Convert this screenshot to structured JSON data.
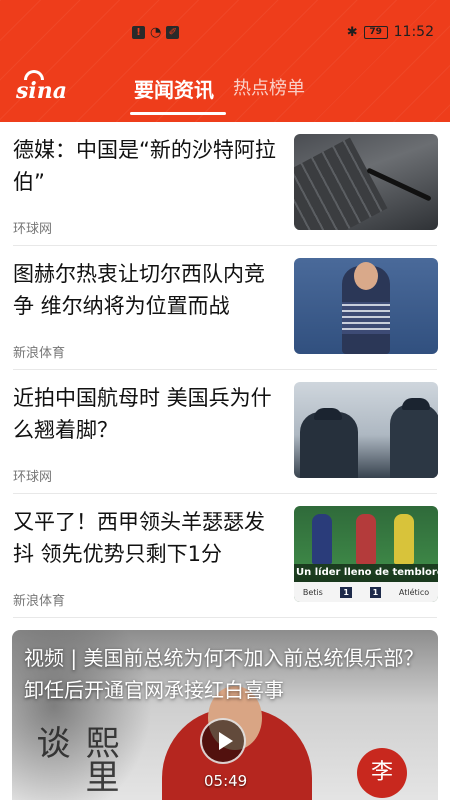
{
  "status_bar": {
    "time": "11:52",
    "battery": "79"
  },
  "header": {
    "logo_text": "sina",
    "tabs": [
      {
        "label": "要闻资讯",
        "active": true
      },
      {
        "label": "热点榜单",
        "active": false
      }
    ],
    "brand_color": "#ee3d1b"
  },
  "feed": {
    "items": [
      {
        "title": "德媒：中国是“新的沙特阿拉伯”",
        "source": "环球网",
        "thumb_icon": "laptop-keyboard-image"
      },
      {
        "title": "图赫尔热衷让切尔西队内竞争 维尔纳将为位置而战",
        "source": "新浪体育",
        "thumb_icon": "football-player-image"
      },
      {
        "title": "近拍中国航母时 美国兵为什么翘着脚？",
        "source": "环球网",
        "thumb_icon": "navy-sailors-image"
      },
      {
        "title": "又平了！西甲领头羊瑟瑟发抖 领先优势只剩下1分",
        "source": "新浪体育",
        "thumb_icon": "soccer-match-image",
        "thumb_caption": "Un líder lleno de temblores",
        "thumb_score": {
          "home": "Betis",
          "home_score": "1",
          "away_score": "1",
          "away": "Atlético"
        }
      }
    ]
  },
  "video_card": {
    "title": "视频 | 美国前总统为何不加入前总统俱乐部？卸任后开通官网承接红白喜事",
    "duration": "05:49",
    "calligraphy": "熙里谈",
    "seal": "李"
  }
}
